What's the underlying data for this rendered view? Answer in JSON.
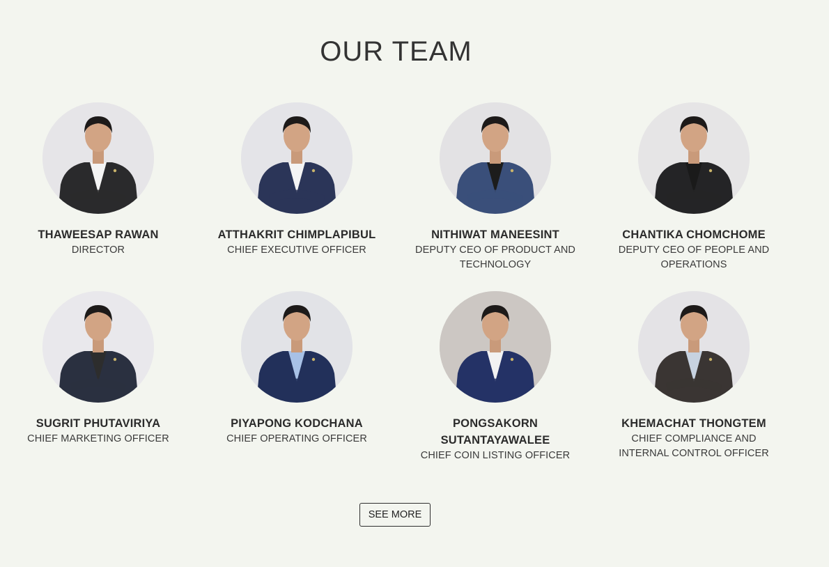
{
  "section": {
    "title": "OUR TEAM"
  },
  "team": [
    {
      "name": "THAWEESAP RAWAN",
      "role": "DIRECTOR",
      "suit": "#2a2a2c",
      "shirt": "#f4f4f4",
      "bg": "#e6e5e8"
    },
    {
      "name": "ATTHAKRIT CHIMPLAPIBUL",
      "role": "CHIEF EXECUTIVE OFFICER",
      "suit": "#2b3558",
      "shirt": "#f4f4f4",
      "bg": "#e4e4e8"
    },
    {
      "name": "NITHIWAT MANEESINT",
      "role": "DEPUTY CEO OF PRODUCT AND TECHNOLOGY",
      "suit": "#3a4f7a",
      "shirt": "#1c1c1c",
      "bg": "#e3e2e4"
    },
    {
      "name": "CHANTIKA CHOMCHOME",
      "role": "DEPUTY CEO OF PEOPLE AND OPERATIONS",
      "suit": "#242426",
      "shirt": "#1a1a1a",
      "bg": "#e6e5e6"
    },
    {
      "name": "SUGRIT PHUTAVIRIYA",
      "role": "CHIEF MARKETING OFFICER",
      "suit": "#2a3040",
      "shirt": "#2d2d2d",
      "bg": "#e9e8ec"
    },
    {
      "name": "PIYAPONG KODCHANA",
      "role": "CHIEF OPERATING OFFICER",
      "suit": "#22305a",
      "shirt": "#a8c1e6",
      "bg": "#e2e3e7"
    },
    {
      "name": "PONGSAKORN SUTANTAYAWALEE",
      "role": "CHIEF COIN LISTING OFFICER",
      "suit": "#243266",
      "shirt": "#f2f2f2",
      "bg": "#ccc7c3"
    },
    {
      "name": "KHEMACHAT THONGTEM",
      "role": "CHIEF COMPLIANCE AND INTERNAL CONTROL OFFICER",
      "suit": "#3a3533",
      "shirt": "#c7d2e0",
      "bg": "#e4e3e6"
    }
  ],
  "actions": {
    "see_more_label": "SEE MORE"
  }
}
